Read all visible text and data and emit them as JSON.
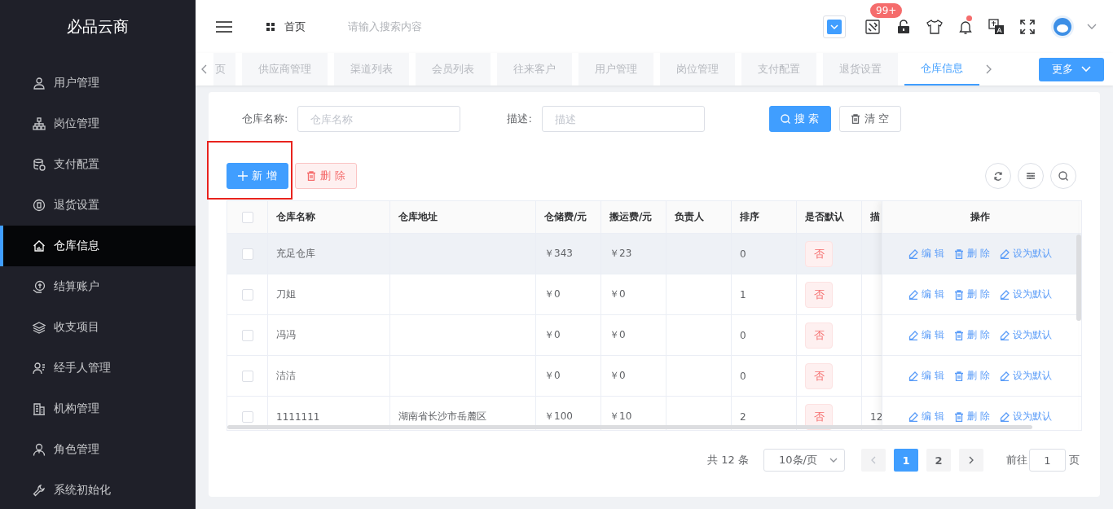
{
  "sidebar": {
    "title": "必品云商",
    "items": [
      {
        "label": "用户管理",
        "selected": false
      },
      {
        "label": "岗位管理",
        "selected": false
      },
      {
        "label": "支付配置",
        "selected": false
      },
      {
        "label": "退货设置",
        "selected": false
      },
      {
        "label": "仓库信息",
        "selected": true
      },
      {
        "label": "结算账户",
        "selected": false
      },
      {
        "label": "收支项目",
        "selected": false
      },
      {
        "label": "经手人管理",
        "selected": false
      },
      {
        "label": "机构管理",
        "selected": false
      },
      {
        "label": "角色管理",
        "selected": false
      },
      {
        "label": "系统初始化",
        "selected": false
      }
    ]
  },
  "header": {
    "breadcrumb": "首页",
    "search": {
      "placeholder": "请输入搜索内容"
    },
    "badge": "99+",
    "bell_dot": true
  },
  "tabs": {
    "items": [
      {
        "label": "页",
        "selected": false
      },
      {
        "label": "供应商管理",
        "selected": false
      },
      {
        "label": "渠道列表",
        "selected": false
      },
      {
        "label": "会员列表",
        "selected": false
      },
      {
        "label": "往来客户",
        "selected": false
      },
      {
        "label": "用户管理",
        "selected": false
      },
      {
        "label": "岗位管理",
        "selected": false
      },
      {
        "label": "支付配置",
        "selected": false
      },
      {
        "label": "退货设置",
        "selected": false
      },
      {
        "label": "仓库信息",
        "selected": true
      }
    ],
    "more": "更多"
  },
  "filters": [
    {
      "label": "仓库名称:",
      "placeholder": "仓库名称"
    },
    {
      "label": "描述:",
      "placeholder": "描述"
    }
  ],
  "filter_buttons": [
    {
      "label": "搜 索",
      "kind": "primary"
    },
    {
      "label": "清 空",
      "kind": "plain"
    }
  ],
  "actions": [
    {
      "label": "新 增",
      "kind": "add",
      "highlighted": true
    },
    {
      "label": "删 除",
      "kind": "danger",
      "highlighted": false
    }
  ],
  "table": {
    "all_checked": false,
    "columns": [
      {
        "label": "仓库名称"
      },
      {
        "label": "仓库地址"
      },
      {
        "label": "仓储费/元"
      },
      {
        "label": "搬运费/元"
      },
      {
        "label": "负责人"
      },
      {
        "label": "排序"
      },
      {
        "label": "是否默认"
      },
      {
        "label": "描"
      }
    ],
    "ops_label": "操作",
    "rows": [
      {
        "checked": false,
        "hovered": true,
        "name": "充足仓库",
        "storage_fee": "￥343",
        "handling_fee": "￥23",
        "sort": "0",
        "default": "否",
        "ops": [
          "编 辑",
          "删 除",
          "设为默认"
        ]
      },
      {
        "checked": false,
        "hovered": false,
        "name": "刀姐",
        "storage_fee": "￥0",
        "handling_fee": "￥0",
        "sort": "1",
        "default": "否",
        "ops": [
          "编 辑",
          "删 除",
          "设为默认"
        ]
      },
      {
        "checked": false,
        "hovered": false,
        "name": "冯冯",
        "storage_fee": "￥0",
        "handling_fee": "￥0",
        "sort": "0",
        "default": "否",
        "ops": [
          "编 辑",
          "删 除",
          "设为默认"
        ]
      },
      {
        "checked": false,
        "hovered": false,
        "name": "洁洁",
        "storage_fee": "￥0",
        "handling_fee": "￥0",
        "sort": "0",
        "default": "否",
        "ops": [
          "编 辑",
          "删 除",
          "设为默认"
        ]
      },
      {
        "checked": false,
        "hovered": false,
        "name": "1111111",
        "address": "湖南省长沙市岳麓区",
        "storage_fee": "￥100",
        "handling_fee": "￥10",
        "sort": "2",
        "default": "否",
        "description": "12",
        "ops": [
          "编 辑",
          "删 除",
          "设为默认"
        ]
      }
    ]
  },
  "pagination": {
    "total": "共 12 条",
    "page_size": "10条/页",
    "pages": [
      {
        "label": "1",
        "selected": true
      },
      {
        "label": "2",
        "selected": false
      }
    ],
    "goto_label": "前往",
    "goto_value": "1",
    "goto_suffix": "页"
  }
}
